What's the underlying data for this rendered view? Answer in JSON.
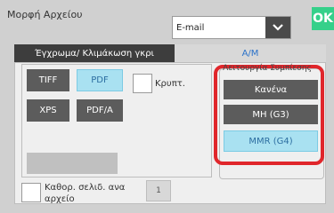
{
  "header": {
    "title": "Μορφή Αρχείου",
    "ok_label": "OK"
  },
  "select": {
    "value": "E-mail"
  },
  "tabs": [
    {
      "label": "Έγχρωμα/ Κλιμάκωση γκρι",
      "active": false
    },
    {
      "label": "Α/Μ",
      "active": true
    }
  ],
  "format_buttons": [
    {
      "label": "TIFF",
      "selected": false
    },
    {
      "label": "PDF",
      "selected": true
    },
    {
      "label": "XPS",
      "selected": false
    },
    {
      "label": "PDF/A",
      "selected": false
    }
  ],
  "encrypt": {
    "label": "Κρυπτ.",
    "checked": false
  },
  "compression": {
    "title": "Λειτουργία Συμπίεσης",
    "options": [
      {
        "label": "Κανένα",
        "selected": false
      },
      {
        "label": "MH (G3)",
        "selected": false
      },
      {
        "label": "MMR (G4)",
        "selected": true
      }
    ]
  },
  "pages_per_file": {
    "label_line1": "Καθορ. σελιδ. ανα",
    "label_line2": "αρχείο",
    "checked": false,
    "value": "1"
  },
  "colors": {
    "accent": "#35d08a",
    "highlight": "#e0262b",
    "selected_bg": "#a9e1f1"
  }
}
